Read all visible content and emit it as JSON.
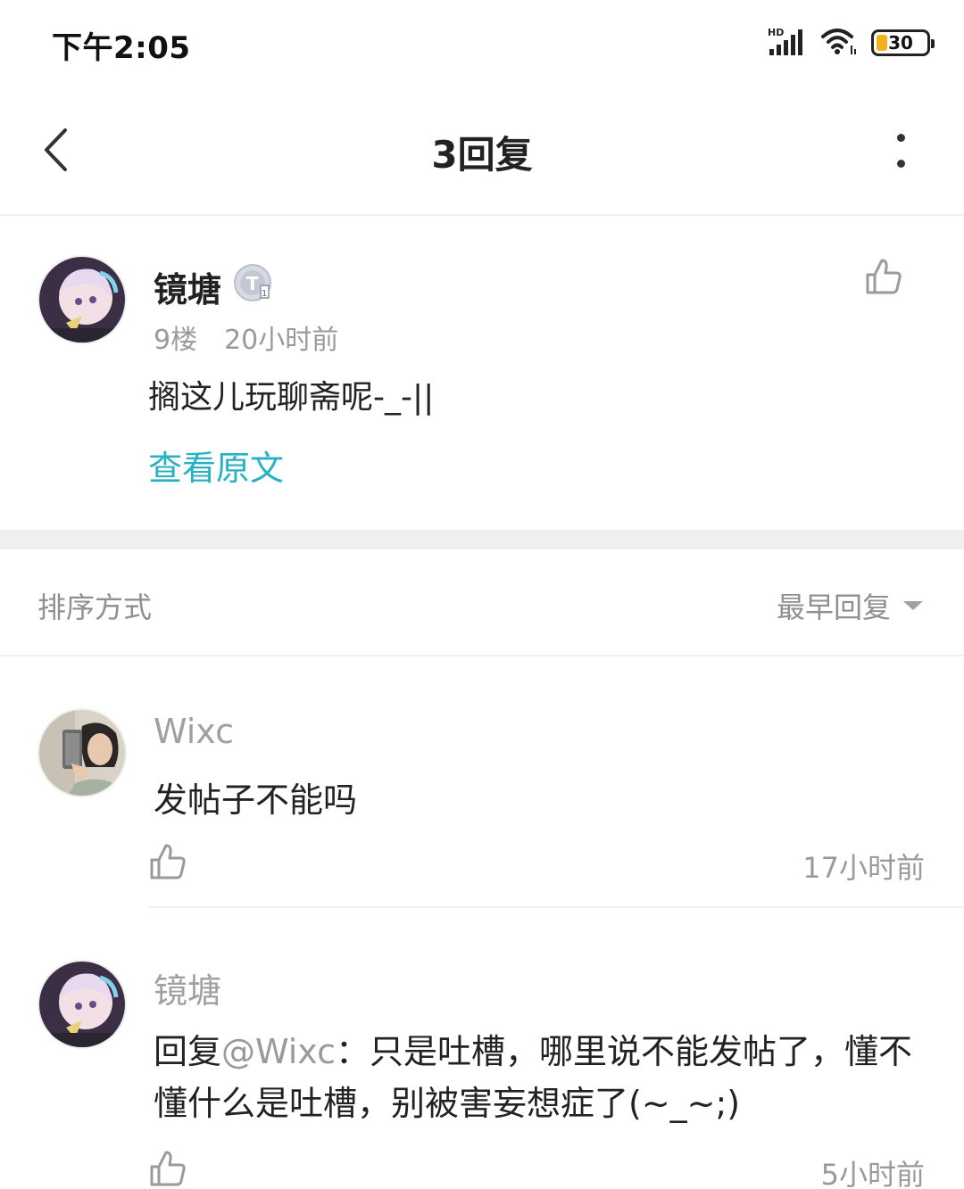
{
  "status_bar": {
    "time": "下午2:05",
    "network": "HD",
    "battery": "30"
  },
  "header": {
    "title": "3回复"
  },
  "main_post": {
    "author": "镜塘",
    "floor": "9楼",
    "time": "20小时前",
    "content": "搁这儿玩聊斋呢-_-||",
    "view_original": "查看原文"
  },
  "sort": {
    "label": "排序方式",
    "selected": "最早回复"
  },
  "replies": [
    {
      "author": "Wixc",
      "text": "发帖子不能吗",
      "time": "17小时前"
    },
    {
      "author": "镜塘",
      "reply_prefix": "回复",
      "mention": "@Wixc",
      "text": "：只是吐槽，哪里说不能发帖了，懂不懂什么是吐槽，别被害妄想症了(~_~;)",
      "time": "5小时前"
    }
  ],
  "colors": {
    "accent": "#27b2c4",
    "meta": "#9a9a9a",
    "divider": "#efefef"
  }
}
